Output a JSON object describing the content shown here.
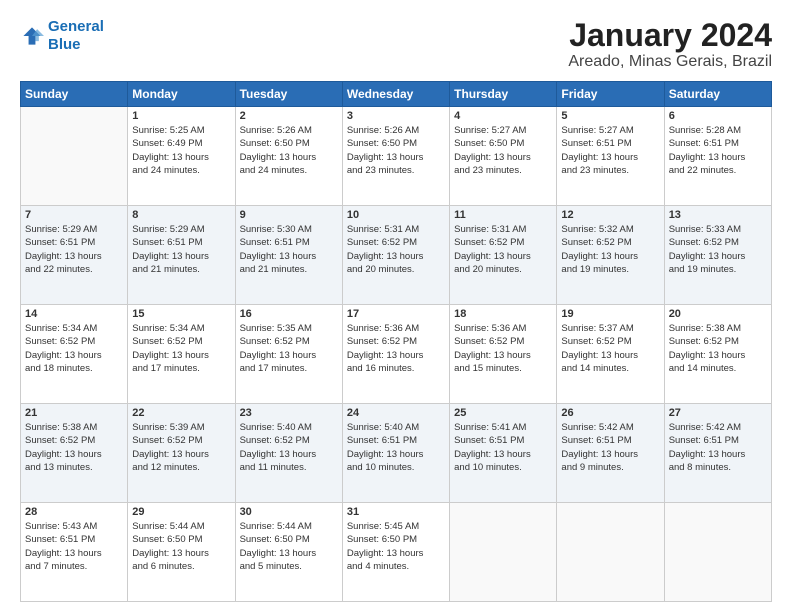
{
  "logo": {
    "line1": "General",
    "line2": "Blue"
  },
  "title": "January 2024",
  "subtitle": "Areado, Minas Gerais, Brazil",
  "weekdays": [
    "Sunday",
    "Monday",
    "Tuesday",
    "Wednesday",
    "Thursday",
    "Friday",
    "Saturday"
  ],
  "weeks": [
    [
      {
        "day": "",
        "info": ""
      },
      {
        "day": "1",
        "info": "Sunrise: 5:25 AM\nSunset: 6:49 PM\nDaylight: 13 hours\nand 24 minutes."
      },
      {
        "day": "2",
        "info": "Sunrise: 5:26 AM\nSunset: 6:50 PM\nDaylight: 13 hours\nand 24 minutes."
      },
      {
        "day": "3",
        "info": "Sunrise: 5:26 AM\nSunset: 6:50 PM\nDaylight: 13 hours\nand 23 minutes."
      },
      {
        "day": "4",
        "info": "Sunrise: 5:27 AM\nSunset: 6:50 PM\nDaylight: 13 hours\nand 23 minutes."
      },
      {
        "day": "5",
        "info": "Sunrise: 5:27 AM\nSunset: 6:51 PM\nDaylight: 13 hours\nand 23 minutes."
      },
      {
        "day": "6",
        "info": "Sunrise: 5:28 AM\nSunset: 6:51 PM\nDaylight: 13 hours\nand 22 minutes."
      }
    ],
    [
      {
        "day": "7",
        "info": "Sunrise: 5:29 AM\nSunset: 6:51 PM\nDaylight: 13 hours\nand 22 minutes."
      },
      {
        "day": "8",
        "info": "Sunrise: 5:29 AM\nSunset: 6:51 PM\nDaylight: 13 hours\nand 21 minutes."
      },
      {
        "day": "9",
        "info": "Sunrise: 5:30 AM\nSunset: 6:51 PM\nDaylight: 13 hours\nand 21 minutes."
      },
      {
        "day": "10",
        "info": "Sunrise: 5:31 AM\nSunset: 6:52 PM\nDaylight: 13 hours\nand 20 minutes."
      },
      {
        "day": "11",
        "info": "Sunrise: 5:31 AM\nSunset: 6:52 PM\nDaylight: 13 hours\nand 20 minutes."
      },
      {
        "day": "12",
        "info": "Sunrise: 5:32 AM\nSunset: 6:52 PM\nDaylight: 13 hours\nand 19 minutes."
      },
      {
        "day": "13",
        "info": "Sunrise: 5:33 AM\nSunset: 6:52 PM\nDaylight: 13 hours\nand 19 minutes."
      }
    ],
    [
      {
        "day": "14",
        "info": "Sunrise: 5:34 AM\nSunset: 6:52 PM\nDaylight: 13 hours\nand 18 minutes."
      },
      {
        "day": "15",
        "info": "Sunrise: 5:34 AM\nSunset: 6:52 PM\nDaylight: 13 hours\nand 17 minutes."
      },
      {
        "day": "16",
        "info": "Sunrise: 5:35 AM\nSunset: 6:52 PM\nDaylight: 13 hours\nand 17 minutes."
      },
      {
        "day": "17",
        "info": "Sunrise: 5:36 AM\nSunset: 6:52 PM\nDaylight: 13 hours\nand 16 minutes."
      },
      {
        "day": "18",
        "info": "Sunrise: 5:36 AM\nSunset: 6:52 PM\nDaylight: 13 hours\nand 15 minutes."
      },
      {
        "day": "19",
        "info": "Sunrise: 5:37 AM\nSunset: 6:52 PM\nDaylight: 13 hours\nand 14 minutes."
      },
      {
        "day": "20",
        "info": "Sunrise: 5:38 AM\nSunset: 6:52 PM\nDaylight: 13 hours\nand 14 minutes."
      }
    ],
    [
      {
        "day": "21",
        "info": "Sunrise: 5:38 AM\nSunset: 6:52 PM\nDaylight: 13 hours\nand 13 minutes."
      },
      {
        "day": "22",
        "info": "Sunrise: 5:39 AM\nSunset: 6:52 PM\nDaylight: 13 hours\nand 12 minutes."
      },
      {
        "day": "23",
        "info": "Sunrise: 5:40 AM\nSunset: 6:52 PM\nDaylight: 13 hours\nand 11 minutes."
      },
      {
        "day": "24",
        "info": "Sunrise: 5:40 AM\nSunset: 6:51 PM\nDaylight: 13 hours\nand 10 minutes."
      },
      {
        "day": "25",
        "info": "Sunrise: 5:41 AM\nSunset: 6:51 PM\nDaylight: 13 hours\nand 10 minutes."
      },
      {
        "day": "26",
        "info": "Sunrise: 5:42 AM\nSunset: 6:51 PM\nDaylight: 13 hours\nand 9 minutes."
      },
      {
        "day": "27",
        "info": "Sunrise: 5:42 AM\nSunset: 6:51 PM\nDaylight: 13 hours\nand 8 minutes."
      }
    ],
    [
      {
        "day": "28",
        "info": "Sunrise: 5:43 AM\nSunset: 6:51 PM\nDaylight: 13 hours\nand 7 minutes."
      },
      {
        "day": "29",
        "info": "Sunrise: 5:44 AM\nSunset: 6:50 PM\nDaylight: 13 hours\nand 6 minutes."
      },
      {
        "day": "30",
        "info": "Sunrise: 5:44 AM\nSunset: 6:50 PM\nDaylight: 13 hours\nand 5 minutes."
      },
      {
        "day": "31",
        "info": "Sunrise: 5:45 AM\nSunset: 6:50 PM\nDaylight: 13 hours\nand 4 minutes."
      },
      {
        "day": "",
        "info": ""
      },
      {
        "day": "",
        "info": ""
      },
      {
        "day": "",
        "info": ""
      }
    ]
  ]
}
